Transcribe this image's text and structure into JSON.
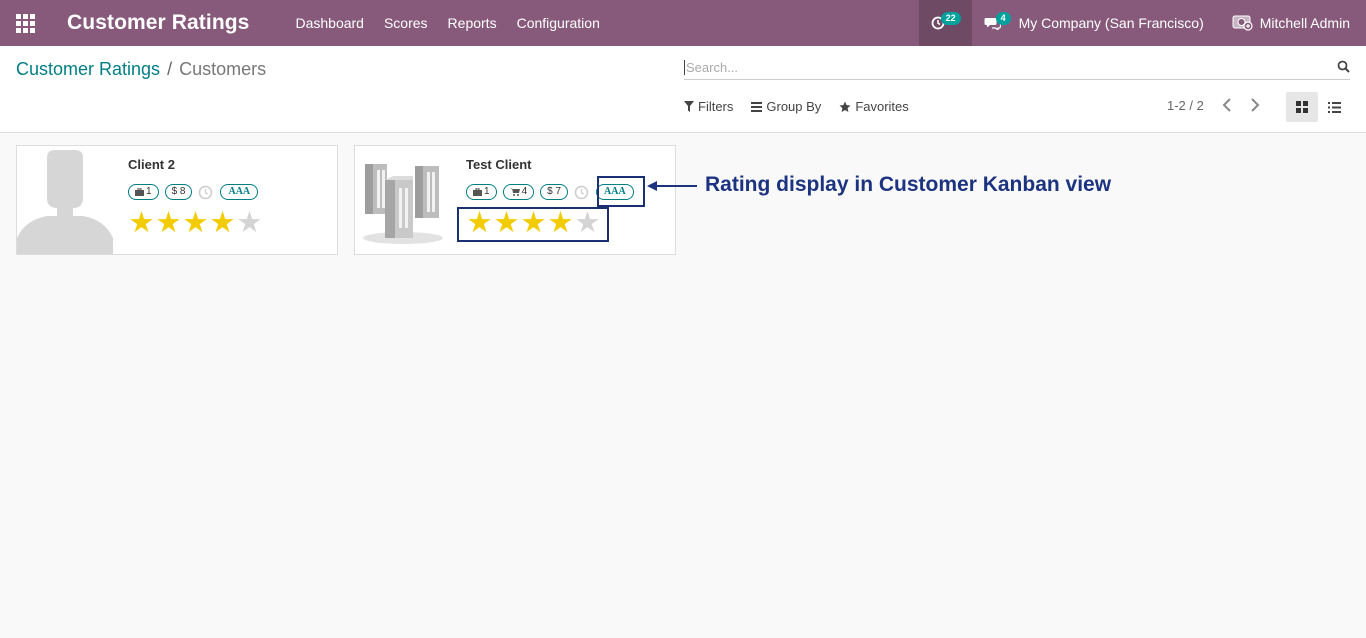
{
  "navbar": {
    "app_title": "Customer Ratings",
    "menu": [
      "Dashboard",
      "Scores",
      "Reports",
      "Configuration"
    ],
    "activity_count": "22",
    "message_count": "4",
    "company": "My Company (San Francisco)",
    "user": "Mitchell Admin",
    "colors": {
      "primary": "#875a7b",
      "badge": "#00a09d"
    }
  },
  "breadcrumb": {
    "root": "Customer Ratings",
    "separator": "/",
    "current": "Customers"
  },
  "search": {
    "placeholder": "Search..."
  },
  "filters": {
    "filters_label": "Filters",
    "group_by_label": "Group By",
    "favorites_label": "Favorites"
  },
  "pager": {
    "text": "1-2 / 2"
  },
  "cards": [
    {
      "name": "Client 2",
      "image": "person-placeholder",
      "tags": {
        "sales": "1",
        "invoiced": "$ 8",
        "rating": "AAA"
      },
      "stars": 4,
      "max_stars": 5
    },
    {
      "name": "Test Client",
      "image": "company-buildings",
      "tags": {
        "sales": "1",
        "purchases": "4",
        "invoiced": "$ 7",
        "rating": "AAA"
      },
      "stars": 4,
      "max_stars": 5
    }
  ],
  "annotation": {
    "text": "Rating display in Customer Kanban view",
    "color": "#1c3380"
  }
}
